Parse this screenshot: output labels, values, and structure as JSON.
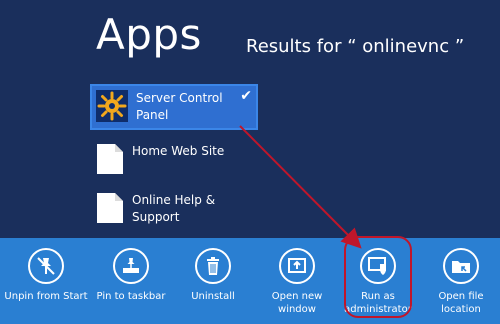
{
  "header": {
    "title": "Apps",
    "results": "Results for “ onlinevnc ”"
  },
  "results": [
    {
      "label_line1": "Server Control",
      "label_line2": "Panel",
      "selected": true,
      "icon": "server-control-panel-icon"
    },
    {
      "label_line1": "Home Web Site",
      "label_line2": "",
      "selected": false,
      "icon": "document-icon"
    },
    {
      "label_line1": "Online Help &",
      "label_line2": "Support",
      "selected": false,
      "icon": "document-icon"
    }
  ],
  "app_bar": {
    "buttons": [
      {
        "label_line1": "Unpin from Start",
        "label_line2": "",
        "icon": "unpin-icon"
      },
      {
        "label_line1": "Pin to taskbar",
        "label_line2": "",
        "icon": "pin-taskbar-icon"
      },
      {
        "label_line1": "Uninstall",
        "label_line2": "",
        "icon": "trash-icon"
      },
      {
        "label_line1": "Open new",
        "label_line2": "window",
        "icon": "new-window-icon"
      },
      {
        "label_line1": "Run as",
        "label_line2": "administrator",
        "icon": "shield-icon"
      },
      {
        "label_line1": "Open file",
        "label_line2": "location",
        "icon": "folder-icon"
      }
    ]
  },
  "colors": {
    "background": "#1a2f5c",
    "selection": "#2f6fd1",
    "app_bar": "#2a7fd2",
    "annotation": "#c0162a"
  }
}
